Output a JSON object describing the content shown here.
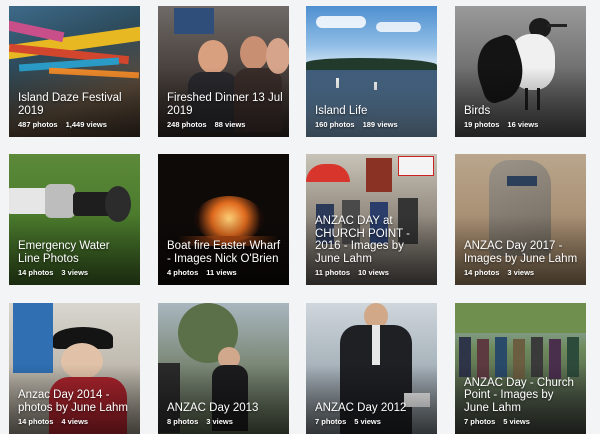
{
  "albums": [
    {
      "title": "Island Daze Festival 2019",
      "photos": "487 photos",
      "views": "1,449 views"
    },
    {
      "title": "Fireshed Dinner 13 Jul 2019",
      "photos": "248 photos",
      "views": "88 views"
    },
    {
      "title": "Island Life",
      "photos": "160 photos",
      "views": "189 views"
    },
    {
      "title": "Birds",
      "photos": "19 photos",
      "views": "16 views"
    },
    {
      "title": "Emergency Water Line Photos",
      "photos": "14 photos",
      "views": "3 views"
    },
    {
      "title": "Boat fire Easter Wharf - Images Nick O'Brien",
      "photos": "4 photos",
      "views": "11 views"
    },
    {
      "title": "ANZAC DAY at CHURCH POINT - 2016 - Images by June Lahm",
      "photos": "11 photos",
      "views": "10 views"
    },
    {
      "title": "ANZAC Day 2017 - Images by June Lahm",
      "photos": "14 photos",
      "views": "3 views"
    },
    {
      "title": "Anzac Day 2014 - photos by June Lahm",
      "photos": "14 photos",
      "views": "4 views"
    },
    {
      "title": "ANZAC Day 2013",
      "photos": "8 photos",
      "views": "3 views"
    },
    {
      "title": "ANZAC Day 2012",
      "photos": "7 photos",
      "views": "5 views"
    },
    {
      "title": "ANZAC Day - Church Point - Images by June Lahm",
      "photos": "7 photos",
      "views": "5 views"
    }
  ]
}
